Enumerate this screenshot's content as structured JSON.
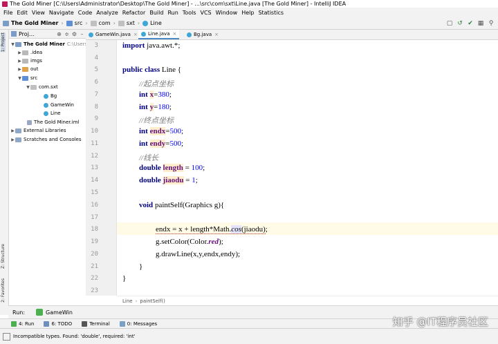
{
  "window": {
    "title": "The Gold Miner [C:\\Users\\Administrator\\Desktop\\The Gold Miner] - ...\\src\\com\\sxt\\Line.java [The Gold Miner] - IntelliJ IDEA"
  },
  "menu": [
    "File",
    "Edit",
    "View",
    "Navigate",
    "Code",
    "Analyze",
    "Refactor",
    "Build",
    "Run",
    "Tools",
    "VCS",
    "Window",
    "Help",
    "Statistics"
  ],
  "breadcrumbs": [
    "The Gold Miner",
    "src",
    "com",
    "sxt",
    "Line"
  ],
  "project_panel": {
    "title": "Proj..."
  },
  "left_tool_tabs": {
    "project": "1: Project",
    "structure": "Z: Structure",
    "favorites": "2: Favorites"
  },
  "tree": [
    {
      "label": "The Gold Miner",
      "extra": "C:\\Users\\"
    },
    {
      "label": ".idea"
    },
    {
      "label": "imgs"
    },
    {
      "label": "out"
    },
    {
      "label": "src"
    },
    {
      "label": "com.sxt"
    },
    {
      "label": "Bg"
    },
    {
      "label": "GameWin"
    },
    {
      "label": "Line"
    },
    {
      "label": "The Gold Miner.iml"
    },
    {
      "label": "External Libraries"
    },
    {
      "label": "Scratches and Consoles"
    }
  ],
  "editor_tabs": [
    {
      "label": "GameWin.java"
    },
    {
      "label": "Line.java"
    },
    {
      "label": "Bg.java"
    }
  ],
  "line_numbers": [
    "3",
    "4",
    "5",
    "6",
    "7",
    "8",
    "9",
    "10",
    "11",
    "12",
    "13",
    "14",
    "15",
    "16",
    "17",
    "18",
    "19",
    "20",
    "21",
    "22",
    "23"
  ],
  "code": {
    "l3_kw": "import",
    "l3_rest": " java.awt.*;",
    "l5_kw1": "public",
    "l5_kw2": "class",
    "l5_rest": " Line {",
    "l6": "//起点坐标",
    "int": "int",
    "x": "x",
    "x_val": "380",
    "y": "y",
    "y_val": "180",
    "l9": "//终点坐标",
    "endx": "endx",
    "endx_val": "500",
    "endy": "endy",
    "endy_val": "500",
    "l12": "//线长",
    "double": "double",
    "length": "length",
    "length_val": "100",
    "jiaodu": "jiaodu",
    "jiaodu_val": "1",
    "void": "void",
    "l16_rest": " paintSelf(Graphics g){",
    "l18_a": "endx = x + length*Math.",
    "cos": "cos",
    "l18_b": "(jiaodu)",
    "semicolon": ";",
    "l19_a": "g.setColor(Color.",
    "red": "red",
    "l19_b": ");",
    "l20": "g.drawLine(x,y,endx,endy);",
    "l21": "}",
    "l22": "}"
  },
  "code_breadcrumb": {
    "class": "Line",
    "method": "paintSelf()"
  },
  "run_bar": {
    "label": "Run:",
    "config": "GameWin"
  },
  "bottom_tabs": [
    "4: Run",
    "6: TODO",
    "Terminal",
    "0: Messages"
  ],
  "status": {
    "message": "Incompatible types. Found: 'double', required: 'int'"
  },
  "watermark": "知乎 @IT程序员社区"
}
